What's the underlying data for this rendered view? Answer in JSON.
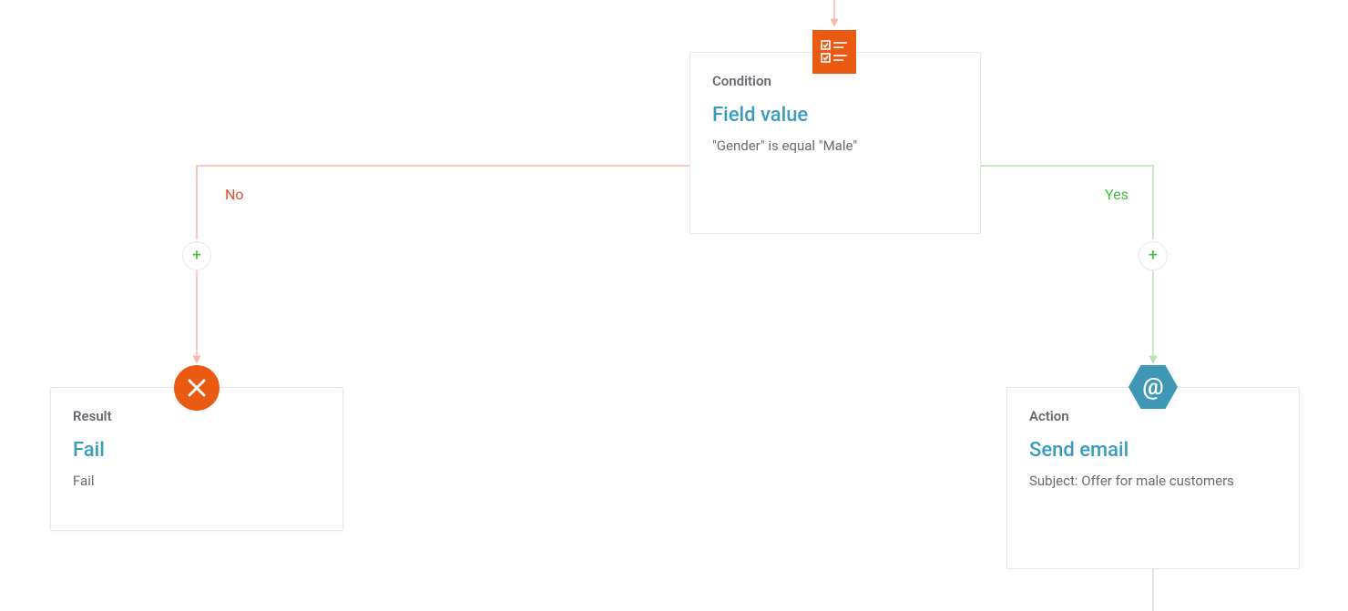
{
  "colors": {
    "orange": "#eb5a13",
    "teal": "#3e97b5",
    "title_teal": "#3a9cbd",
    "no": "#e04e2f",
    "yes": "#3fbf3f",
    "line_red": "#f6b8ac",
    "line_green": "#b7e3b0"
  },
  "branches": {
    "no": "No",
    "yes": "Yes"
  },
  "condition": {
    "eyebrow": "Condition",
    "title": "Field value",
    "description": "\"Gender\" is equal \"Male\""
  },
  "result": {
    "eyebrow": "Result",
    "title": "Fail",
    "description": "Fail"
  },
  "action": {
    "eyebrow": "Action",
    "title": "Send email",
    "description": "Subject: Offer for male customers"
  }
}
